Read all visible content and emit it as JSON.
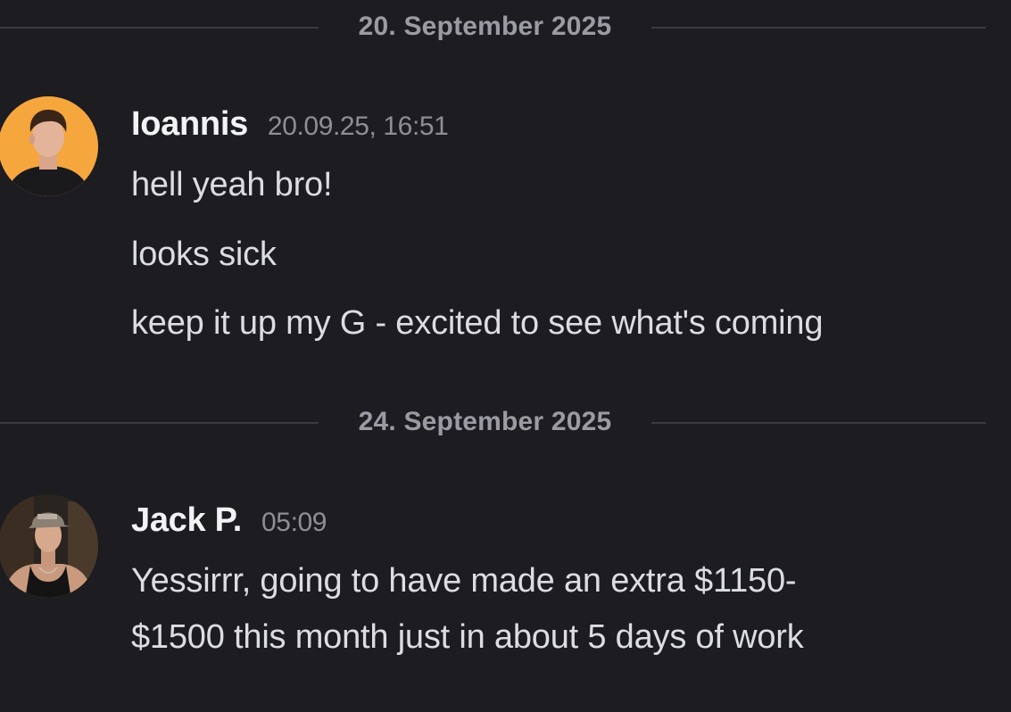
{
  "dividers": [
    {
      "date": "20. September 2025"
    },
    {
      "date": "24. September 2025"
    }
  ],
  "messages": [
    {
      "author": "Ioannis",
      "timestamp": "20.09.25, 16:51",
      "avatar": "user-avatar-ioannis",
      "lines": [
        "hell yeah bro!",
        "looks sick",
        "keep it up my G - excited to see what's coming"
      ]
    },
    {
      "author": "Jack P.",
      "timestamp": "05:09",
      "avatar": "user-avatar-jack",
      "lines": [
        "Yessirrr, going to have made an extra $1150-",
        "$1500 this month just in about 5 days of work"
      ]
    }
  ],
  "colors": {
    "background": "#1c1c21",
    "username": "#f2f3f5",
    "message_text": "#dcdde1",
    "timestamp": "#8e8e96",
    "divider_line": "#3a3a41",
    "divider_text": "#9b9ba3",
    "avatar_ioannis_bg": "#f3a33a"
  }
}
